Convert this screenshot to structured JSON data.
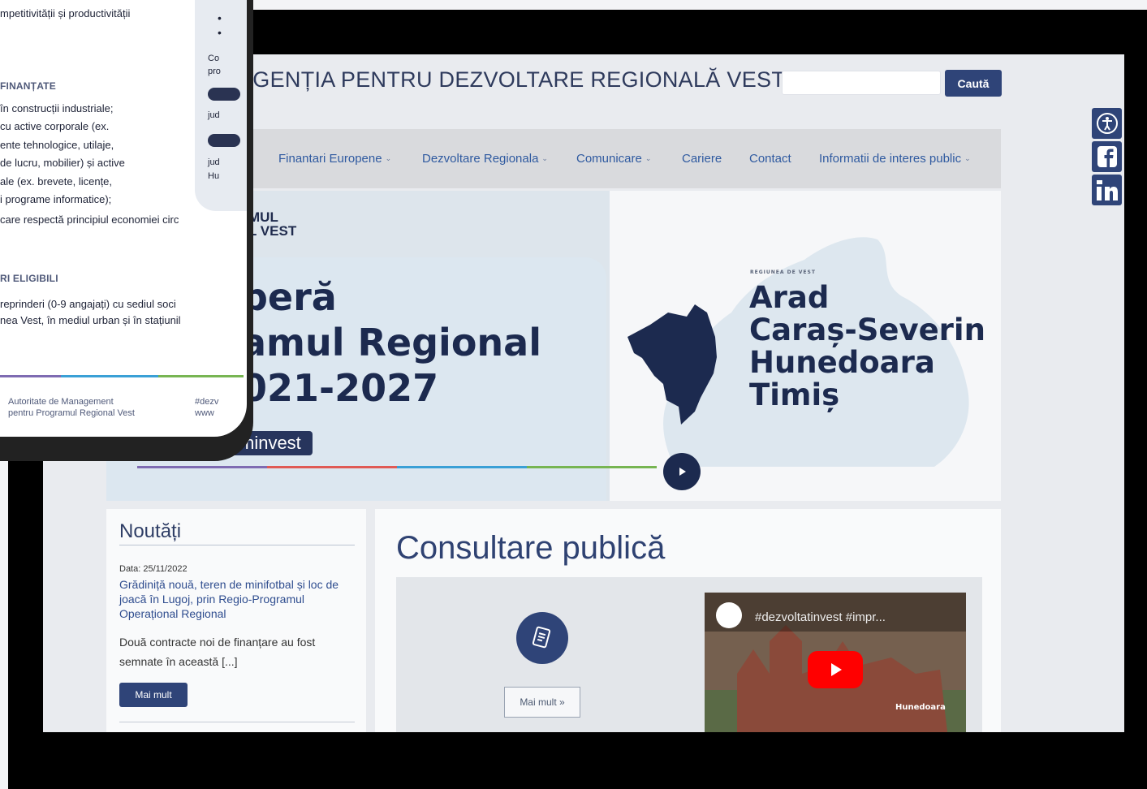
{
  "site": {
    "title": "AGENȚIA PENTRU DEZVOLTARE REGIONALĂ VEST",
    "search_button": "Caută"
  },
  "nav": {
    "items": [
      {
        "label": "Finantari Europene",
        "dropdown": true
      },
      {
        "label": "Dezvoltare Regionala",
        "dropdown": true
      },
      {
        "label": "Comunicare",
        "dropdown": true
      },
      {
        "label": "Cariere",
        "dropdown": false
      },
      {
        "label": "Contact",
        "dropdown": false
      },
      {
        "label": "Informatii de interes public",
        "dropdown": true
      }
    ]
  },
  "social": [
    "accessibility-icon",
    "facebook-icon",
    "linkedin-icon"
  ],
  "hero": {
    "brand_line1": "MUL",
    "brand_line2": "L VEST",
    "line1": "peră",
    "line2": "amul Regional",
    "line3": "021-2027",
    "tag": "minvest",
    "region_tag": "REGIUNEA DE VEST",
    "counties": [
      "Arad",
      "Caraș-Severin",
      "Hunedoara",
      "Timiș"
    ]
  },
  "news": {
    "title": "Noutăți",
    "date": "Data: 25/11/2022",
    "headline": "Grădiniță nouă, teren de minifotbal și loc de joacă în Lugoj, prin Regio-Programul Operațional Regional",
    "excerpt": "Două contracte noi de finanțare au fost semnate în această [...]",
    "more_button": "Mai mult"
  },
  "consult": {
    "title": "Consultare publică",
    "more_button": "Mai mult »",
    "video_title": "#dezvoltatinvest #impr...",
    "video_location": "Hunedoara"
  },
  "phone": {
    "line_top": "mpetitivității și productivității",
    "heading_fin": "FINANȚATE",
    "fin_lines": [
      "în construcții industriale;",
      "cu   active   corporale   (ex.",
      "ente   tehnologice,   utilaje,",
      "de lucru, mobilier) și active",
      "ale   (ex.   brevete,   licențe,",
      "i programe informatice);",
      "care respectă principiul economiei circ"
    ],
    "heading_elig": "RI ELIGIBILI",
    "elig_lines": [
      "reprinderi (0-9 angajați) cu sediul soci",
      "nea Vest, în mediul urban și în stațiunil"
    ],
    "card_lines": [
      "Co",
      "pro",
      "jud",
      "jud",
      "Hu"
    ],
    "footer_left1": "Autoritate de Management",
    "footer_left2": "pentru Programul Regional Vest",
    "footer_right1": "#dezv",
    "footer_right2": "www"
  },
  "colors": {
    "brand": "#2f4478",
    "nav_link": "#2f5aa0",
    "hero_text": "#1c2a4f"
  }
}
